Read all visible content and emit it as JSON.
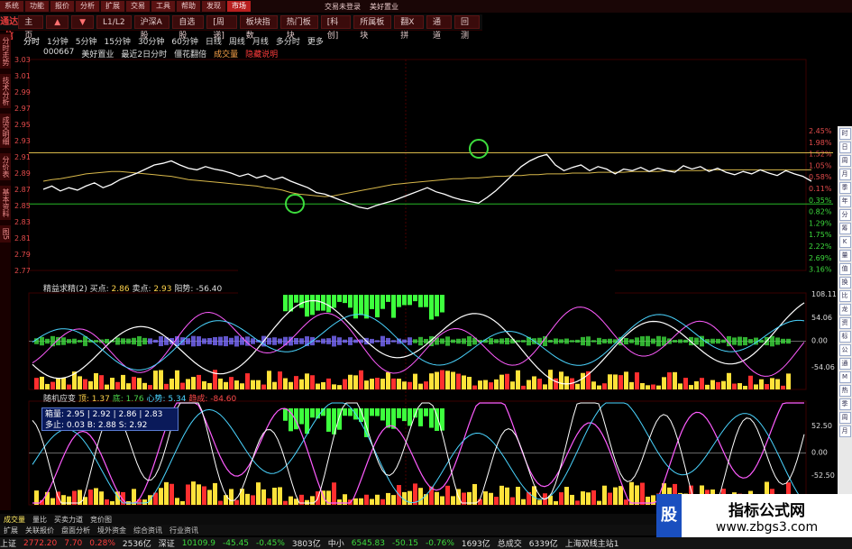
{
  "menubar": {
    "items": [
      "系统",
      "功能",
      "报价",
      "分析",
      "扩展",
      "交易",
      "工具",
      "帮助",
      "发现",
      "市场"
    ],
    "status": "交易未登录",
    "stock": "美好置业",
    "active_index": 9
  },
  "tabbar": {
    "logo": "通达信",
    "tabs": [
      "主页",
      "▲",
      "▼",
      "L1/L2",
      "沪深A股",
      "自选股",
      "[周递]",
      "板块指数",
      "热门板块",
      "[科创]",
      "所属板块",
      "翻X拼",
      "通道",
      "回测"
    ]
  },
  "periods": [
    "分时",
    "1分钟",
    "5分钟",
    "15分钟",
    "30分钟",
    "60分钟",
    "日线",
    "周线",
    "月线",
    "多分时",
    "更多"
  ],
  "info": {
    "code": "000667",
    "name": "美好置业",
    "range": "最近2日分时",
    "mode": "僵花翻倍",
    "indicator": "成交量",
    "note": "隐藏说明"
  },
  "left_tabs": [
    "分时走势",
    "技术分析",
    "成交明细",
    "分价表",
    "基本资料",
    "图5"
  ],
  "main_chart": {
    "ylim": [
      2.77,
      3.03
    ],
    "left_ticks": [
      "3.03",
      "3.01",
      "2.99",
      "2.97",
      "2.95",
      "2.93",
      "2.91",
      "2.89",
      "2.87",
      "2.85",
      "2.83",
      "2.81",
      "2.79",
      "2.77"
    ],
    "right_ticks": [
      "2.45%",
      "1.98%",
      "1.52%",
      "1.05%",
      "0.58%",
      "0.11%",
      "0.35%",
      "0.82%",
      "1.29%",
      "1.75%",
      "2.22%",
      "2.69%",
      "3.16%"
    ],
    "upper_line": 2.915,
    "lower_line": 2.852,
    "price": [
      2.87,
      2.874,
      2.868,
      2.872,
      2.869,
      2.874,
      2.878,
      2.872,
      2.876,
      2.882,
      2.886,
      2.89,
      2.895,
      2.9,
      2.902,
      2.905,
      2.9,
      2.896,
      2.894,
      2.898,
      2.895,
      2.893,
      2.89,
      2.886,
      2.889,
      2.884,
      2.887,
      2.882,
      2.885,
      2.88,
      2.876,
      2.872,
      2.866,
      2.864,
      2.86,
      2.856,
      2.852,
      2.848,
      2.846,
      2.85,
      2.853,
      2.856,
      2.86,
      2.864,
      2.868,
      2.872,
      2.867,
      2.864,
      2.86,
      2.857,
      2.855,
      2.853,
      2.86,
      2.868,
      2.878,
      2.888,
      2.898,
      2.905,
      2.91,
      2.913,
      2.9,
      2.893,
      2.897,
      2.9,
      2.893,
      2.898,
      2.895,
      2.889,
      2.895,
      2.893,
      2.897,
      2.892,
      2.896,
      2.893,
      2.891,
      2.899,
      2.895,
      2.898,
      2.892,
      2.896,
      2.891,
      2.888,
      2.892,
      2.889,
      2.894,
      2.89,
      2.887,
      2.893,
      2.889,
      2.886,
      2.88
    ],
    "avg": [
      2.88,
      2.882,
      2.883,
      2.885,
      2.887,
      2.889,
      2.89,
      2.891,
      2.892,
      2.892,
      2.891,
      2.89,
      2.889,
      2.888,
      2.887,
      2.886,
      2.884,
      2.882,
      2.881,
      2.88,
      2.879,
      2.878,
      2.877,
      2.876,
      2.875,
      2.874,
      2.872,
      2.871,
      2.869,
      2.866,
      2.864,
      2.863,
      2.862,
      2.861,
      2.862,
      2.864,
      2.866,
      2.868,
      2.87,
      2.872,
      2.874,
      2.876,
      2.877,
      2.878,
      2.879,
      2.88,
      2.881,
      2.882,
      2.883,
      2.883,
      2.884,
      2.884,
      2.885,
      2.886,
      2.886,
      2.887,
      2.887,
      2.888,
      2.888,
      2.889,
      2.889,
      2.889,
      2.89,
      2.89,
      2.89,
      2.891,
      2.891,
      2.891,
      2.891,
      2.892,
      2.892,
      2.892,
      2.892,
      2.893,
      2.893,
      2.893,
      2.893,
      2.893,
      2.894,
      2.894,
      2.894,
      2.894,
      2.894,
      2.894,
      2.894,
      2.894,
      2.894,
      2.894,
      2.894,
      2.894,
      2.894
    ]
  },
  "panel1": {
    "title_name": "精益求精(2)",
    "buy_label": "买点:",
    "buy_value": "2.86",
    "sell_label": "卖点:",
    "sell_value": "2.93",
    "sun_label": "阳势:",
    "sun_value": "-56.40",
    "right_ticks": [
      "108.11",
      "54.06",
      "0.00",
      "-54.06"
    ]
  },
  "panel2": {
    "title_name": "随机应变",
    "t1": "顶: 1.37",
    "t2": "底: 1.76",
    "t3": "心势: 5.34",
    "t4": "趋成: -84.60",
    "right_ticks": [
      "52.50",
      "0.00",
      "-52.50"
    ],
    "tooltip_line1": "箱量: 2.95 | 2.92 | 2.86 | 2.83",
    "tooltip_line2": "多止: 0.03  B: 2.88  S: 2.92"
  },
  "bottom_tabs": [
    "成交量",
    "量比",
    "买卖力道",
    "竞价图"
  ],
  "subtabs": [
    "扩展",
    "关联报价",
    "盘面分析",
    "境外资金",
    "综合资讯",
    "行业资讯"
  ],
  "statusbar": {
    "items": [
      {
        "text": "上证",
        "cls": "wt"
      },
      {
        "text": "2772.20",
        "cls": "up"
      },
      {
        "text": "7.70",
        "cls": "up"
      },
      {
        "text": "0.28%",
        "cls": "up"
      },
      {
        "text": "2536亿",
        "cls": "wt"
      },
      {
        "text": "深证",
        "cls": "wt"
      },
      {
        "text": "10109.9",
        "cls": "dn"
      },
      {
        "text": "-45.45",
        "cls": "dn"
      },
      {
        "text": "-0.45%",
        "cls": "dn"
      },
      {
        "text": "3803亿",
        "cls": "wt"
      },
      {
        "text": "中小",
        "cls": "wt"
      },
      {
        "text": "6545.83",
        "cls": "dn"
      },
      {
        "text": "-50.15",
        "cls": "dn"
      },
      {
        "text": "-0.76%",
        "cls": "dn"
      },
      {
        "text": "1693亿",
        "cls": "wt"
      },
      {
        "text": "总成交",
        "cls": "wt"
      },
      {
        "text": "6339亿",
        "cls": "wt"
      },
      {
        "text": "上海双线主站1",
        "cls": "wt"
      }
    ]
  },
  "right_toolbar": [
    "时",
    "日",
    "周",
    "月",
    "季",
    "年",
    "分",
    "筹",
    "K",
    "量",
    "值",
    "换",
    "比",
    "龙",
    "资",
    "标",
    "公",
    "通",
    "M",
    "热",
    "季",
    "周",
    "月"
  ],
  "watermark": {
    "badge": "股",
    "title": "指标公式网",
    "url": "www.zbgs3.com"
  },
  "colors": {
    "price": "#ffffff",
    "avg": "#d8b84a",
    "upper": "#d8b84a",
    "lower": "#27b827",
    "accent_red": "#b81f1f"
  }
}
